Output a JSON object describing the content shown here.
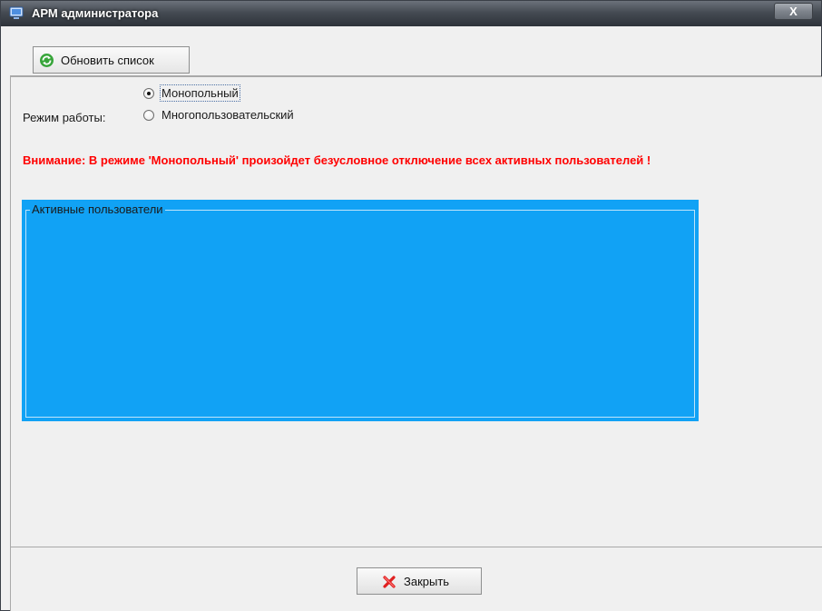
{
  "window": {
    "title": "АРМ администратора",
    "close_glyph": "X"
  },
  "toolbar": {
    "refresh_label": "Обновить список",
    "refresh_icon": "refresh-icon"
  },
  "mode": {
    "label": "Режим работы:",
    "options": [
      {
        "label": "Монопольный",
        "checked": true
      },
      {
        "label": "Многопользовательский",
        "checked": false
      }
    ]
  },
  "warning": "Внимание: В режиме 'Монопольный' произойдет безусловное отключение всех активных пользователей !",
  "users_panel": {
    "title": "Активные пользователи",
    "background": "#11a2f5"
  },
  "footer": {
    "close_label": "Закрыть",
    "close_icon": "x-icon"
  },
  "colors": {
    "warning": "#ff0000",
    "panel": "#11a2f5"
  }
}
